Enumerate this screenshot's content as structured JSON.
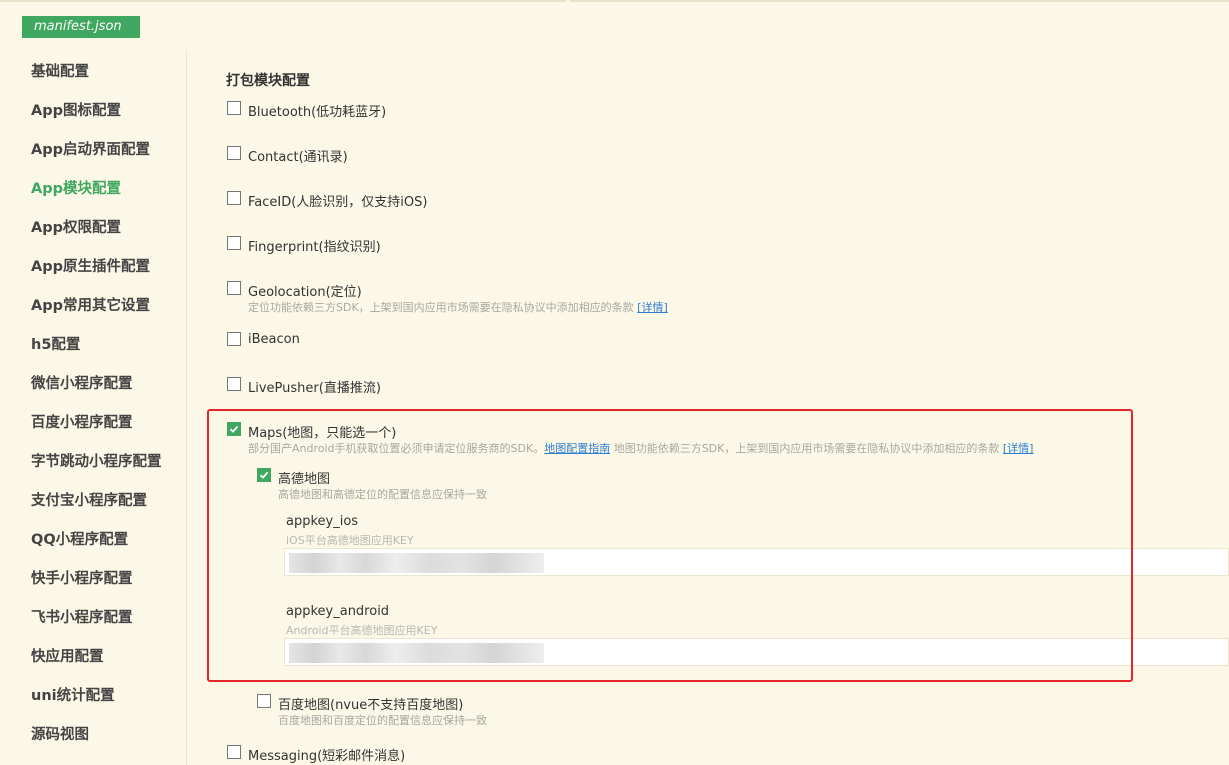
{
  "file_tab": "manifest.json",
  "sidebar": {
    "items": [
      {
        "label": "基础配置",
        "active": false
      },
      {
        "label": "App图标配置",
        "active": false
      },
      {
        "label": "App启动界面配置",
        "active": false
      },
      {
        "label": "App模块配置",
        "active": true
      },
      {
        "label": "App权限配置",
        "active": false
      },
      {
        "label": "App原生插件配置",
        "active": false
      },
      {
        "label": "App常用其它设置",
        "active": false
      },
      {
        "label": "h5配置",
        "active": false
      },
      {
        "label": "微信小程序配置",
        "active": false
      },
      {
        "label": "百度小程序配置",
        "active": false
      },
      {
        "label": "字节跳动小程序配置",
        "active": false
      },
      {
        "label": "支付宝小程序配置",
        "active": false
      },
      {
        "label": "QQ小程序配置",
        "active": false
      },
      {
        "label": "快手小程序配置",
        "active": false
      },
      {
        "label": "飞书小程序配置",
        "active": false
      },
      {
        "label": "快应用配置",
        "active": false
      },
      {
        "label": "uni统计配置",
        "active": false
      },
      {
        "label": "源码视图",
        "active": false
      }
    ]
  },
  "main": {
    "section_title": "打包模块配置",
    "modules": {
      "bluetooth": {
        "label": "Bluetooth(低功耗蓝牙)",
        "checked": false
      },
      "contact": {
        "label": "Contact(通讯录)",
        "checked": false
      },
      "faceid": {
        "label": "FaceID(人脸识别，仅支持iOS)",
        "checked": false
      },
      "fingerprint": {
        "label": "Fingerprint(指纹识别)",
        "checked": false
      },
      "geolocation": {
        "label": "Geolocation(定位)",
        "checked": false,
        "hint": "定位功能依赖三方SDK，上架到国内应用市场需要在隐私协议中添加相应的条款",
        "hint_link": "[详情]"
      },
      "ibeacon": {
        "label": "iBeacon",
        "checked": false
      },
      "livepusher": {
        "label": "LivePusher(直播推流)",
        "checked": false
      },
      "maps": {
        "label": "Maps(地图，只能选一个)",
        "checked": true,
        "hint_pre": "部分国产Android手机获取位置必须申请定位服务商的SDK。",
        "hint_link1": "地图配置指南",
        "hint_mid": " 地图功能依赖三方SDK，上架到国内应用市场需要在隐私协议中添加相应的条款 ",
        "hint_link2": "[详情]",
        "amap": {
          "label": "高德地图",
          "checked": true,
          "hint": "高德地图和高德定位的配置信息应保持一致",
          "appkey_ios": {
            "label": "appkey_ios",
            "hint": "iOS平台高德地图应用KEY"
          },
          "appkey_android": {
            "label": "appkey_android",
            "hint": "Android平台高德地图应用KEY"
          }
        },
        "baidu": {
          "label": "百度地图(nvue不支持百度地图)",
          "checked": false,
          "hint": "百度地图和百度定位的配置信息应保持一致"
        }
      },
      "messaging": {
        "label": "Messaging(短彩邮件消息)",
        "checked": false
      }
    }
  },
  "colors": {
    "accent": "#3fa75f",
    "background": "#fcf8e8",
    "highlight": "#e5262b",
    "link": "#2f7fd1"
  }
}
